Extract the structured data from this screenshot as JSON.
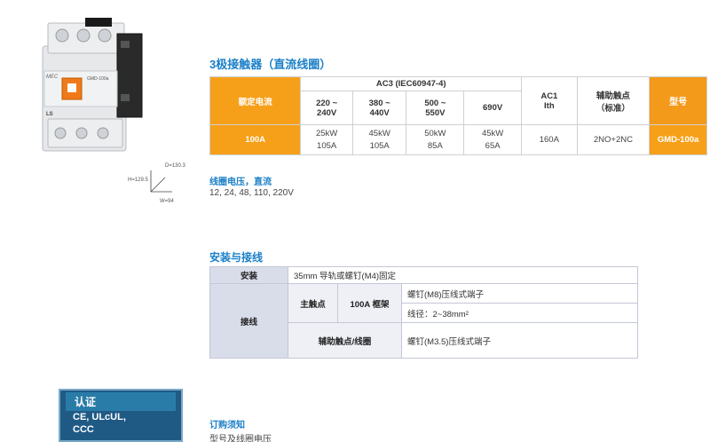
{
  "product": {
    "brand": "MEC",
    "model_label": "GMD-100a",
    "ls_label": "LS"
  },
  "dimensions": {
    "h": "H=129.5",
    "d": "D=130.3",
    "w": "W=94"
  },
  "section1": {
    "title": "3极接触器（直流线圈）",
    "table": {
      "rated_current": "额定电流",
      "ac3_header": "AC3 (IEC60947-4)",
      "ac3_cols": [
        "220 ~\n240V",
        "380 ~\n440V",
        "500 ~\n550V",
        "690V"
      ],
      "ac1_header": "AC1\nIth",
      "aux_header": "辅助触点\n（标准）",
      "type_header": "型号",
      "row": {
        "current": "100A",
        "ac3_vals": [
          [
            "25kW",
            "105A"
          ],
          [
            "45kW",
            "105A"
          ],
          [
            "50kW",
            "85A"
          ],
          [
            "45kW",
            "65A"
          ]
        ],
        "ac1": "160A",
        "aux": "2NO+2NC",
        "type": "GMD-100a"
      }
    }
  },
  "coil": {
    "title": "线圈电压，直流",
    "values": "12, 24, 48, 110, 220V"
  },
  "section2": {
    "title": "安装与接线",
    "install_label": "安装",
    "install_value": "35mm  导轨或螺钉(M4)固定",
    "wiring_label": "接线",
    "main_contact": "主触点",
    "frame": "100A 框架",
    "main_terminal": "螺钉(M8)压线式端子",
    "wire_dia": "线径：2~38mm²",
    "aux_label": "辅助触点/线圈",
    "aux_terminal": "螺钉(M3.5)压线式端子"
  },
  "cert": {
    "title": "认证",
    "items": [
      "CE, ULcUL,",
      "CCC"
    ]
  },
  "order": {
    "title": "订购须知",
    "line1": "型号及线圈电压"
  }
}
